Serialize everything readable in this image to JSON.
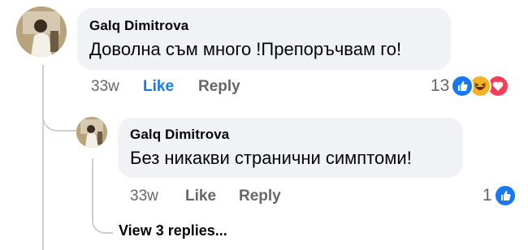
{
  "comment": {
    "author": "Galq Dimitrova",
    "text": "Доволна съм много !Препоръчвам го!",
    "timestamp": "33w",
    "like_label": "Like",
    "reply_label": "Reply",
    "reaction_count": "13",
    "reactions": [
      "like-icon",
      "haha-icon",
      "love-icon"
    ],
    "liked": true
  },
  "reply": {
    "author": "Galq Dimitrova",
    "text": "Без никакви странични симптоми!",
    "timestamp": "33w",
    "like_label": "Like",
    "reply_label": "Reply",
    "reaction_count": "1",
    "reactions": [
      "like-icon"
    ],
    "liked": false
  },
  "view_replies_label": "View 3 replies...",
  "colors": {
    "like_blue": "#1877f2",
    "bubble_bg": "#f0f2f5",
    "meta_gray": "#65676b",
    "haha_yellow": "#f7b125",
    "love_red": "#f33e58"
  }
}
